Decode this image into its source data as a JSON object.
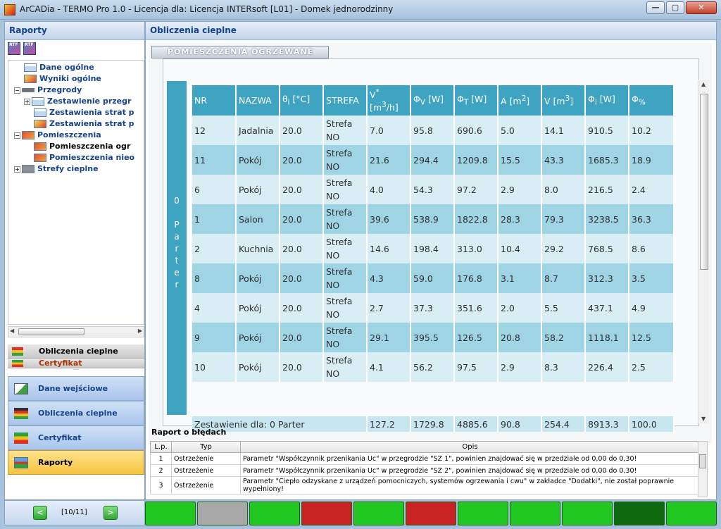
{
  "window": {
    "title": "ArCADia - TERMO Pro 1.0 - Licencja dla: Licencja INTERsoft [L01] - Domek jednorodzinny",
    "buttons": {
      "minimize": "—",
      "maximize": "▢",
      "close": "✕"
    }
  },
  "left_panel": {
    "header": "Raporty",
    "toolbar": {
      "rtf1": "RTF",
      "rtf2": "RTF"
    },
    "tree": [
      {
        "label": "Dane ogólne",
        "icon": "table-icon",
        "level": 1
      },
      {
        "label": "Wyniki ogólne",
        "icon": "chart-icon",
        "level": 1
      },
      {
        "label": "Przegrody",
        "icon": "wall-icon",
        "level": 0,
        "expander": "−"
      },
      {
        "label": "Zestawienie przegr",
        "icon": "table-icon",
        "level": 1,
        "expander": "+"
      },
      {
        "label": "Zestawienia strat p",
        "icon": "table-icon",
        "level": 2
      },
      {
        "label": "Zestawienia strat p",
        "icon": "chart-icon",
        "level": 2
      },
      {
        "label": "Pomieszczenia",
        "icon": "room-icon",
        "level": 0,
        "expander": "−"
      },
      {
        "label": "Pomieszczenia ogr",
        "icon": "room-icon",
        "level": 2,
        "selected": true
      },
      {
        "label": "Pomieszczenia nieo",
        "icon": "room-icon",
        "level": 2
      },
      {
        "label": "Strefy cieplne",
        "icon": "zone-icon",
        "level": 0,
        "expander": "+"
      }
    ],
    "small_nav": [
      {
        "label": "Obliczenia cieplne"
      },
      {
        "label": "Certyfikat"
      }
    ],
    "big_nav": [
      {
        "label": "Dane wejściowe",
        "icon": "pencil-icon"
      },
      {
        "label": "Obliczenia cieplne",
        "icon": "calc-icon"
      },
      {
        "label": "Certyfikat",
        "icon": "energy-bars-icon"
      },
      {
        "label": "Raporty",
        "icon": "report-icon",
        "active": true
      }
    ],
    "pager": {
      "prev": "<",
      "text": "[10/11]",
      "next": ">"
    }
  },
  "main": {
    "header": "Obliczenia cieplne",
    "tab_label": "POMIESZCZENIA OGRZEWANE",
    "side_label": [
      "0",
      "",
      "P",
      "a",
      "r",
      "t",
      "e",
      "r"
    ],
    "columns": [
      "NR",
      "NAZWA",
      "θi [°C]",
      "STREFA",
      "V* [m3/h]",
      "ΦV [W]",
      "ΦT [W]",
      "A [m2]",
      "V [m3]",
      "Φi [W]",
      "Φ%"
    ],
    "rows": [
      [
        "12",
        "Jadalnia",
        "20.0",
        "Strefa NO",
        "7.0",
        "95.8",
        "690.6",
        "5.0",
        "14.1",
        "910.5",
        "10.2"
      ],
      [
        "11",
        "Pokój",
        "20.0",
        "Strefa NO",
        "21.6",
        "294.4",
        "1209.8",
        "15.5",
        "43.3",
        "1685.3",
        "18.9"
      ],
      [
        "6",
        "Pokój",
        "20.0",
        "Strefa NO",
        "4.0",
        "54.3",
        "97.2",
        "2.9",
        "8.0",
        "216.5",
        "2.4"
      ],
      [
        "1",
        "Salon",
        "20.0",
        "Strefa NO",
        "39.6",
        "538.9",
        "1822.8",
        "28.3",
        "79.3",
        "3238.5",
        "36.3"
      ],
      [
        "2",
        "Kuchnia",
        "20.0",
        "Strefa NO",
        "14.6",
        "198.4",
        "313.0",
        "10.4",
        "29.2",
        "768.5",
        "8.6"
      ],
      [
        "8",
        "Pokój",
        "20.0",
        "Strefa NO",
        "4.3",
        "59.0",
        "176.8",
        "3.1",
        "8.7",
        "312.3",
        "3.5"
      ],
      [
        "4",
        "Pokój",
        "20.0",
        "Strefa NO",
        "2.7",
        "37.3",
        "351.6",
        "2.0",
        "5.5",
        "437.1",
        "4.9"
      ],
      [
        "9",
        "Pokój",
        "20.0",
        "Strefa NO",
        "29.1",
        "395.5",
        "126.5",
        "20.8",
        "58.2",
        "1118.1",
        "12.5"
      ],
      [
        "10",
        "Pokój",
        "20.0",
        "Strefa NO",
        "4.1",
        "56.2",
        "97.5",
        "2.9",
        "8.3",
        "226.4",
        "2.5"
      ]
    ],
    "summary": [
      "Zestawienie dla: 0 Parter",
      "127.2",
      "1729.8",
      "4885.6",
      "90.8",
      "254.4",
      "8913.3",
      "100.0"
    ]
  },
  "errors": {
    "title": "Raport o błędach",
    "columns": [
      "L.p.",
      "Typ",
      "Opis"
    ],
    "rows": [
      [
        "1",
        "Ostrzeżenie",
        "Parametr \"Współczynnik przenikania Uc\" w przegrodzie \"SZ 1\", powinien znajdować się w przedziale od 0,00 do 0,30!"
      ],
      [
        "2",
        "Ostrzeżenie",
        "Parametr \"Współczynnik przenikania Uc\" w przegrodzie \"SZ 2\", powinien znajdować się w przedziale od 0,00 do 0,30!"
      ],
      [
        "3",
        "Ostrzeżenie",
        "Parametr \"Ciepło odzyskane z urządzeń pomocniczych, systemów ogrzewania i cwu\" w zakładce \"Dodatki\", nie został poprawnie wypełniony!"
      ]
    ]
  },
  "status_blocks": [
    "#22c822",
    "#a8a8a8",
    "#22c822",
    "#c82222",
    "#22c822",
    "#c82222",
    "#22c822",
    "#22c822",
    "#22c822",
    "#0e6a0e",
    "#22c822"
  ]
}
